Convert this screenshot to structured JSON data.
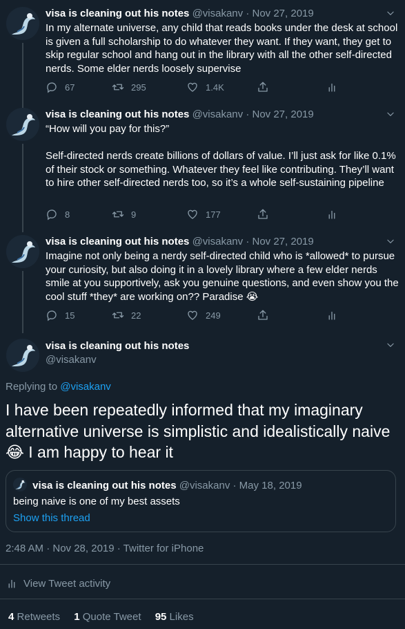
{
  "colors": {
    "background": "#15202b",
    "accent": "#1da1f2",
    "muted": "#8899a6",
    "border": "#38444d"
  },
  "author": {
    "name": "visa is cleaning out his notes",
    "handle": "@visakanv"
  },
  "tweets": [
    {
      "date": "Nov 27, 2019",
      "text": "In my alternate universe, any child that reads books under the desk at school is given a full scholarship to do whatever they want. If they want, they get to skip regular school and hang out in the library with all the other self-directed nerds. Some elder nerds loosely supervise",
      "replies": "67",
      "retweets": "295",
      "likes": "1.4K"
    },
    {
      "date": "Nov 27, 2019",
      "text": "“How will you pay for this?”\n\nSelf-directed nerds create billions of dollars of value. I’ll just ask for like 0.1% of their stock or something. Whatever they feel like contributing. They’ll want to hire other self-directed nerds too, so it’s a whole self-sustaining pipeline",
      "replies": "8",
      "retweets": "9",
      "likes": "177"
    },
    {
      "date": "Nov 27, 2019",
      "text": "Imagine not only being a nerdy self-directed child who is *allowed* to pursue your curiosity, but also doing it in a lovely library where a few elder nerds smile at you supportively, ask you genuine questions, and even show you the cool stuff *they* are working on?? Paradise 😭",
      "replies": "15",
      "retweets": "22",
      "likes": "249"
    }
  ],
  "main_tweet": {
    "replying_prefix": "Replying to",
    "replying_to": "@visakanv",
    "text": "I have been repeatedly informed that my imaginary alternative universe is simplistic and idealistically naive 😂 I am happy to hear it",
    "quote": {
      "name": "visa is cleaning out his notes",
      "handle": "@visakanv",
      "date": "May 18, 2019",
      "text": "being naive is one of my best assets",
      "link": "Show this thread"
    },
    "timestamp": "2:48 AM · Nov 28, 2019 · Twitter for iPhone",
    "activity_label": "View Tweet activity",
    "stats": [
      {
        "count": "4",
        "label": "Retweets"
      },
      {
        "count": "1",
        "label": "Quote Tweet"
      },
      {
        "count": "95",
        "label": "Likes"
      }
    ]
  },
  "icons": [
    "reply-icon",
    "retweet-icon",
    "like-icon",
    "share-icon",
    "analytics-icon",
    "chevron-down-icon"
  ]
}
